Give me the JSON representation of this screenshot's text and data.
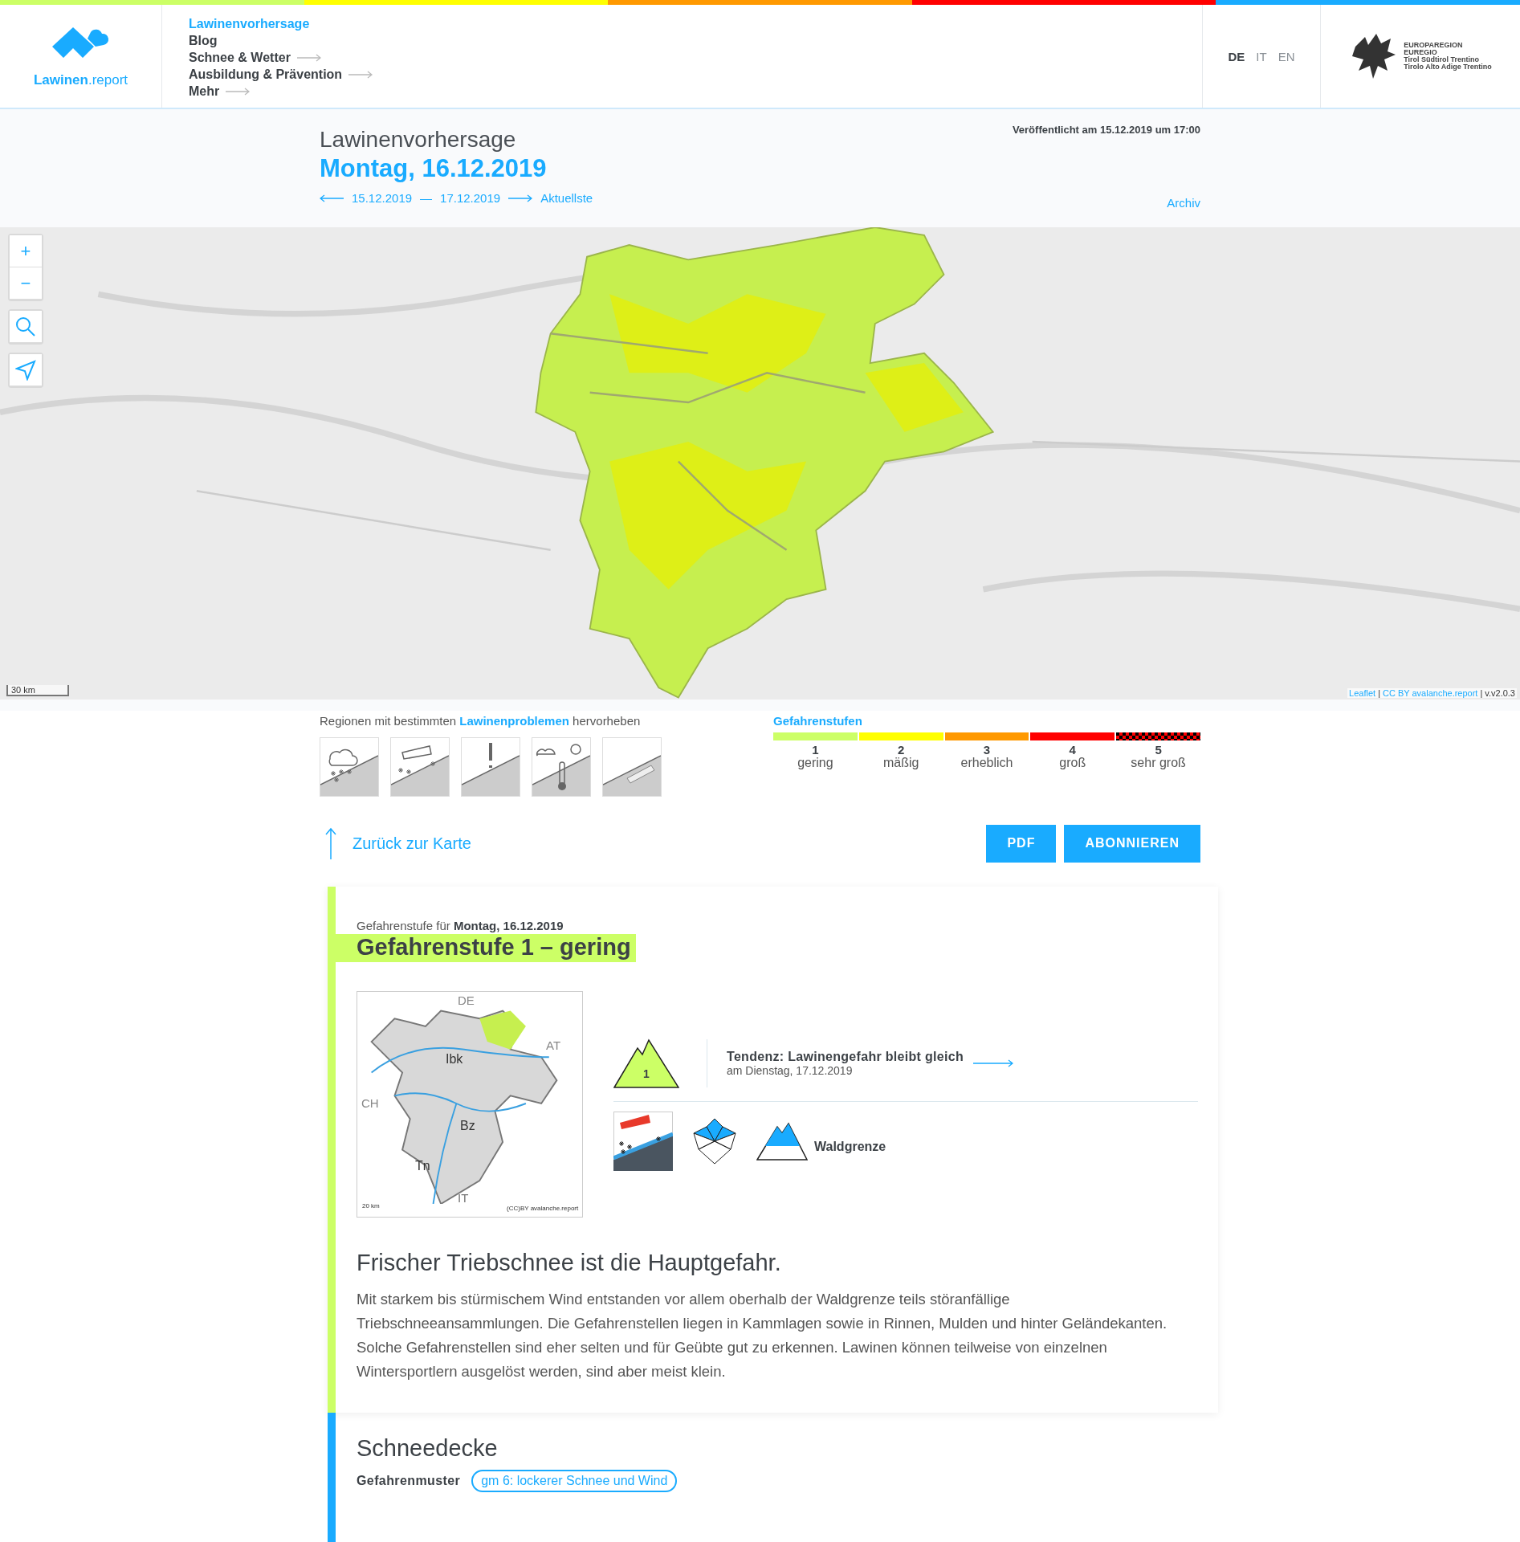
{
  "header": {
    "logo": {
      "name": "Lawinen",
      "suffix": ".report"
    },
    "nav": [
      {
        "label": "Lawinenvorhersage",
        "selected": true,
        "submenu": false
      },
      {
        "label": "Blog",
        "selected": false,
        "submenu": false
      },
      {
        "label": "Schnee & Wetter",
        "selected": false,
        "submenu": true
      },
      {
        "label": "Ausbildung & Prävention",
        "selected": false,
        "submenu": true
      },
      {
        "label": "Mehr",
        "selected": false,
        "submenu": true
      }
    ],
    "languages": [
      {
        "label": "DE",
        "selected": true
      },
      {
        "label": "IT",
        "selected": false
      },
      {
        "label": "EN",
        "selected": false
      }
    ],
    "partner_logo": [
      "EUROPAREGION",
      "EUREGIO",
      "Tirol Südtirol Trentino",
      "Tirolo Alto Adige Trentino"
    ]
  },
  "bulletin_header": {
    "title": "Lawinenvorhersage",
    "date": "Montag, 16.12.2019",
    "published": "Veröffentlicht am 15.12.2019 um 17:00",
    "previous": "15.12.2019",
    "separator": "—",
    "next": "17.12.2019",
    "latest": "Aktuellste",
    "archive": "Archiv"
  },
  "map": {
    "zoom_in": "+",
    "zoom_out": "−",
    "scale": "30 km",
    "attribution": [
      {
        "kind": "link",
        "text": "Leaflet"
      },
      {
        "kind": "plain",
        "text": "|"
      },
      {
        "kind": "link",
        "text": "CC BY avalanche.report"
      },
      {
        "kind": "plain",
        "text": "|"
      },
      {
        "kind": "plain",
        "text": "v.v2.0.3"
      }
    ]
  },
  "problems_filter": {
    "text": "Regionen mit bestimmten **Lawinenproblemen** hervorheben"
  },
  "danger_scale": {
    "title": "Gefahrenstufen",
    "levels": [
      {
        "number": "1",
        "label": "gering",
        "color": "#ccff66",
        "kind": "solid"
      },
      {
        "number": "2",
        "label": "mäßig",
        "color": "#ffff00",
        "kind": "solid"
      },
      {
        "number": "3",
        "label": "erheblich",
        "color": "#ff9900",
        "kind": "solid"
      },
      {
        "number": "4",
        "label": "groß",
        "color": "#ff0000",
        "kind": "solid"
      },
      {
        "number": "5",
        "label": "sehr groß",
        "color": "#ff0000",
        "kind": "checkered"
      }
    ]
  },
  "actions": {
    "back": "Zurück zur Karte",
    "buttons": [
      "PDF",
      "ABONNIEREN"
    ]
  },
  "bulletin": {
    "subtitle": "Gefahrenstufe für **Montag, 16.12.2019**",
    "heading": "Gefahrenstufe 1 – gering",
    "mini_map": [
      "DE",
      "AT",
      "CH",
      "IT",
      "Ibk",
      "Bz",
      "Tn",
      "20 km",
      "(CC)BY avalanche.report"
    ],
    "danger_icon_level": "1",
    "tendency": {
      "title": "Tendenz: Lawinengefahr bleibt gleich",
      "date": "am Dienstag, 17.12.2019"
    },
    "elevation": "Waldgrenze",
    "highlight": "Frischer Triebschnee ist die Hauptgefahr.",
    "text": "Mit starkem bis stürmischem Wind entstanden vor allem oberhalb der Waldgrenze teils störanfällige Triebschneeansammlungen. Die Gefahrenstellen liegen in Kammlagen sowie in Rinnen, Mulden und hinter Geländekanten. Solche Gefahrenstellen sind eher selten und für Geübte gut zu erkennen. Lawinen können teilweise von einzelnen Wintersportlern ausgelöst werden, sind aber meist klein."
  },
  "snowpack": {
    "title": "Schneedecke",
    "pattern_label": "Gefahrenmuster",
    "pattern": "gm 6: lockerer Schnee und Wind"
  }
}
